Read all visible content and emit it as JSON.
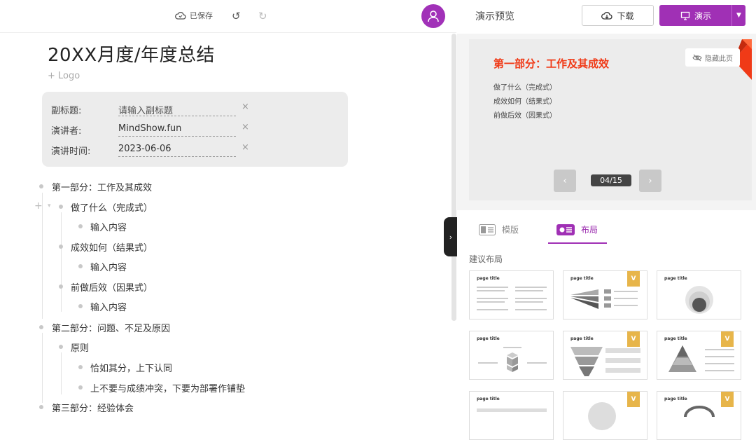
{
  "toolbar": {
    "saved_label": "已保存"
  },
  "document": {
    "title": "20XX月度/年度总结",
    "logo_label": "+ Logo",
    "meta": [
      {
        "label": "副标题:",
        "value": "请输入副标题"
      },
      {
        "label": "演讲者:",
        "value": "MindShow.fun"
      },
      {
        "label": "演讲时间:",
        "value": "2023-06-06"
      }
    ],
    "clear_symbol": "×",
    "outline": [
      "第一部分：工作及其成效",
      "做了什么（完成式）",
      "输入内容",
      "成效如何（结果式）",
      "输入内容",
      "前做后效（因果式）",
      "输入内容",
      "第二部分：问题、不足及原因",
      "原则",
      "恰如其分，上下认同",
      "上不要与成绩冲突，下要为部署作铺垫",
      "第三部分：经验体会"
    ]
  },
  "preview": {
    "title": "演示预览",
    "download_label": "下载",
    "present_label": "演示",
    "slide": {
      "heading": "第一部分：工作及其成效",
      "lines": [
        "做了什么（完成式）",
        "成效如何（结果式）",
        "前做后效（因果式）"
      ],
      "hide_label": "隐藏此页"
    },
    "page_indicator": "04/15",
    "tabs": {
      "template": "模版",
      "layout": "布局"
    },
    "suggest_title": "建议布局",
    "thumb_title": "page title",
    "badge": "V"
  },
  "colors": {
    "accent": "#a030b5",
    "slide_heading": "#f03a17",
    "badge": "#e7b54a"
  }
}
